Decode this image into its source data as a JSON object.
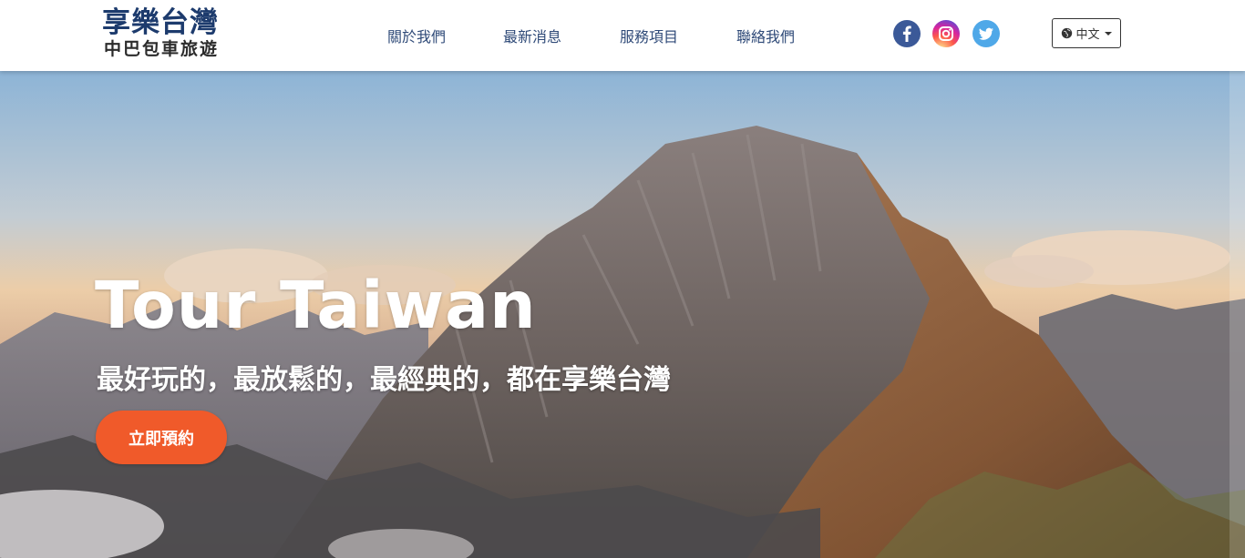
{
  "brand": {
    "line1": "享樂台灣",
    "line2": "中巴包車旅遊",
    "color": "#1d3b6d"
  },
  "nav": {
    "items": [
      {
        "label": "關於我們"
      },
      {
        "label": "最新消息"
      },
      {
        "label": "服務項目"
      },
      {
        "label": "聯絡我們"
      }
    ]
  },
  "social": {
    "icons": [
      "facebook-icon",
      "instagram-icon",
      "twitter-icon"
    ]
  },
  "language": {
    "selected": "中文",
    "icon": "globe-icon"
  },
  "hero": {
    "title": "Tour Taiwan",
    "subtitle": "最好玩的，最放鬆的，最經典的，都在享樂台灣",
    "cta_label": "立即預約",
    "cta_color": "#f05a2a"
  }
}
